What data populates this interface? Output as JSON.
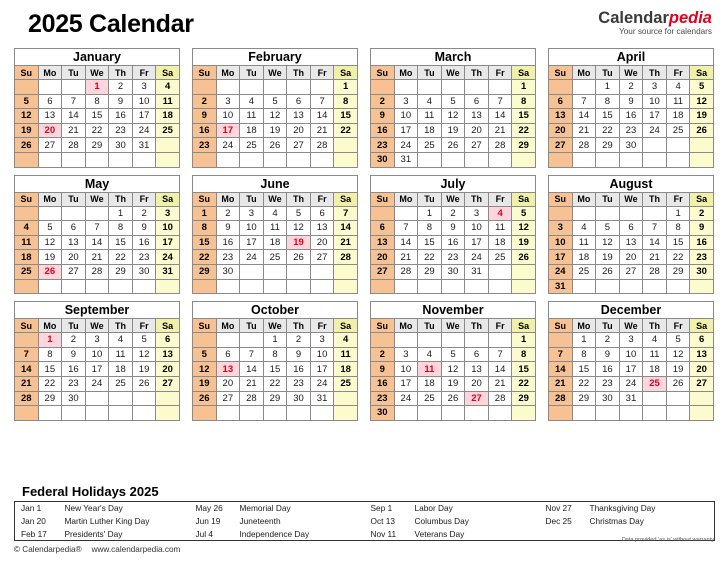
{
  "header": {
    "title": "2025 Calendar",
    "brand_name_1": "Calendar",
    "brand_name_2": "pedia",
    "brand_tagline": "Your source for calendars"
  },
  "colors": {
    "sunday_bg": "#f7c293",
    "saturday_bg": "#fbfbcd",
    "saturday_header_bg": "#f0f0a8",
    "weekday_header_bg": "#e8e8e8",
    "holiday_bg": "#fcd5dd",
    "holiday_text": "#e2001a",
    "brand_accent": "#e2001a",
    "border": "#8a8a8a"
  },
  "weekdays": [
    "Su",
    "Mo",
    "Tu",
    "We",
    "Th",
    "Fr",
    "Sa"
  ],
  "months": [
    {
      "name": "January",
      "weeks": [
        [
          "",
          "",
          "",
          "1",
          "2",
          "3",
          "4"
        ],
        [
          "5",
          "6",
          "7",
          "8",
          "9",
          "10",
          "11"
        ],
        [
          "12",
          "13",
          "14",
          "15",
          "16",
          "17",
          "18"
        ],
        [
          "19",
          "20",
          "21",
          "22",
          "23",
          "24",
          "25"
        ],
        [
          "26",
          "27",
          "28",
          "29",
          "30",
          "31",
          ""
        ],
        [
          "",
          "",
          "",
          "",
          "",
          "",
          ""
        ]
      ],
      "holidays": [
        "1",
        "20"
      ]
    },
    {
      "name": "February",
      "weeks": [
        [
          "",
          "",
          "",
          "",
          "",
          "",
          "1"
        ],
        [
          "2",
          "3",
          "4",
          "5",
          "6",
          "7",
          "8"
        ],
        [
          "9",
          "10",
          "11",
          "12",
          "13",
          "14",
          "15"
        ],
        [
          "16",
          "17",
          "18",
          "19",
          "20",
          "21",
          "22"
        ],
        [
          "23",
          "24",
          "25",
          "26",
          "27",
          "28",
          ""
        ],
        [
          "",
          "",
          "",
          "",
          "",
          "",
          ""
        ]
      ],
      "holidays": [
        "17"
      ]
    },
    {
      "name": "March",
      "weeks": [
        [
          "",
          "",
          "",
          "",
          "",
          "",
          "1"
        ],
        [
          "2",
          "3",
          "4",
          "5",
          "6",
          "7",
          "8"
        ],
        [
          "9",
          "10",
          "11",
          "12",
          "13",
          "14",
          "15"
        ],
        [
          "16",
          "17",
          "18",
          "19",
          "20",
          "21",
          "22"
        ],
        [
          "23",
          "24",
          "25",
          "26",
          "27",
          "28",
          "29"
        ],
        [
          "30",
          "31",
          "",
          "",
          "",
          "",
          ""
        ]
      ],
      "holidays": []
    },
    {
      "name": "April",
      "weeks": [
        [
          "",
          "",
          "1",
          "2",
          "3",
          "4",
          "5"
        ],
        [
          "6",
          "7",
          "8",
          "9",
          "10",
          "11",
          "12"
        ],
        [
          "13",
          "14",
          "15",
          "16",
          "17",
          "18",
          "19"
        ],
        [
          "20",
          "21",
          "22",
          "23",
          "24",
          "25",
          "26"
        ],
        [
          "27",
          "28",
          "29",
          "30",
          "",
          "",
          ""
        ],
        [
          "",
          "",
          "",
          "",
          "",
          "",
          ""
        ]
      ],
      "holidays": []
    },
    {
      "name": "May",
      "weeks": [
        [
          "",
          "",
          "",
          "",
          "1",
          "2",
          "3"
        ],
        [
          "4",
          "5",
          "6",
          "7",
          "8",
          "9",
          "10"
        ],
        [
          "11",
          "12",
          "13",
          "14",
          "15",
          "16",
          "17"
        ],
        [
          "18",
          "19",
          "20",
          "21",
          "22",
          "23",
          "24"
        ],
        [
          "25",
          "26",
          "27",
          "28",
          "29",
          "30",
          "31"
        ],
        [
          "",
          "",
          "",
          "",
          "",
          "",
          ""
        ]
      ],
      "holidays": [
        "26"
      ]
    },
    {
      "name": "June",
      "weeks": [
        [
          "1",
          "2",
          "3",
          "4",
          "5",
          "6",
          "7"
        ],
        [
          "8",
          "9",
          "10",
          "11",
          "12",
          "13",
          "14"
        ],
        [
          "15",
          "16",
          "17",
          "18",
          "19",
          "20",
          "21"
        ],
        [
          "22",
          "23",
          "24",
          "25",
          "26",
          "27",
          "28"
        ],
        [
          "29",
          "30",
          "",
          "",
          "",
          "",
          ""
        ],
        [
          "",
          "",
          "",
          "",
          "",
          "",
          ""
        ]
      ],
      "holidays": [
        "19"
      ]
    },
    {
      "name": "July",
      "weeks": [
        [
          "",
          "",
          "1",
          "2",
          "3",
          "4",
          "5"
        ],
        [
          "6",
          "7",
          "8",
          "9",
          "10",
          "11",
          "12"
        ],
        [
          "13",
          "14",
          "15",
          "16",
          "17",
          "18",
          "19"
        ],
        [
          "20",
          "21",
          "22",
          "23",
          "24",
          "25",
          "26"
        ],
        [
          "27",
          "28",
          "29",
          "30",
          "31",
          "",
          ""
        ],
        [
          "",
          "",
          "",
          "",
          "",
          "",
          ""
        ]
      ],
      "holidays": [
        "4"
      ]
    },
    {
      "name": "August",
      "weeks": [
        [
          "",
          "",
          "",
          "",
          "",
          "1",
          "2"
        ],
        [
          "3",
          "4",
          "5",
          "6",
          "7",
          "8",
          "9"
        ],
        [
          "10",
          "11",
          "12",
          "13",
          "14",
          "15",
          "16"
        ],
        [
          "17",
          "18",
          "19",
          "20",
          "21",
          "22",
          "23"
        ],
        [
          "24",
          "25",
          "26",
          "27",
          "28",
          "29",
          "30"
        ],
        [
          "31",
          "",
          "",
          "",
          "",
          "",
          ""
        ]
      ],
      "holidays": []
    },
    {
      "name": "September",
      "weeks": [
        [
          "",
          "1",
          "2",
          "3",
          "4",
          "5",
          "6"
        ],
        [
          "7",
          "8",
          "9",
          "10",
          "11",
          "12",
          "13"
        ],
        [
          "14",
          "15",
          "16",
          "17",
          "18",
          "19",
          "20"
        ],
        [
          "21",
          "22",
          "23",
          "24",
          "25",
          "26",
          "27"
        ],
        [
          "28",
          "29",
          "30",
          "",
          "",
          "",
          ""
        ],
        [
          "",
          "",
          "",
          "",
          "",
          "",
          ""
        ]
      ],
      "holidays": [
        "1"
      ]
    },
    {
      "name": "October",
      "weeks": [
        [
          "",
          "",
          "",
          "1",
          "2",
          "3",
          "4"
        ],
        [
          "5",
          "6",
          "7",
          "8",
          "9",
          "10",
          "11"
        ],
        [
          "12",
          "13",
          "14",
          "15",
          "16",
          "17",
          "18"
        ],
        [
          "19",
          "20",
          "21",
          "22",
          "23",
          "24",
          "25"
        ],
        [
          "26",
          "27",
          "28",
          "29",
          "30",
          "31",
          ""
        ],
        [
          "",
          "",
          "",
          "",
          "",
          "",
          ""
        ]
      ],
      "holidays": [
        "13"
      ]
    },
    {
      "name": "November",
      "weeks": [
        [
          "",
          "",
          "",
          "",
          "",
          "",
          "1"
        ],
        [
          "2",
          "3",
          "4",
          "5",
          "6",
          "7",
          "8"
        ],
        [
          "9",
          "10",
          "11",
          "12",
          "13",
          "14",
          "15"
        ],
        [
          "16",
          "17",
          "18",
          "19",
          "20",
          "21",
          "22"
        ],
        [
          "23",
          "24",
          "25",
          "26",
          "27",
          "28",
          "29"
        ],
        [
          "30",
          "",
          "",
          "",
          "",
          "",
          ""
        ]
      ],
      "holidays": [
        "11",
        "27"
      ]
    },
    {
      "name": "December",
      "weeks": [
        [
          "",
          "1",
          "2",
          "3",
          "4",
          "5",
          "6"
        ],
        [
          "7",
          "8",
          "9",
          "10",
          "11",
          "12",
          "13"
        ],
        [
          "14",
          "15",
          "16",
          "17",
          "18",
          "19",
          "20"
        ],
        [
          "21",
          "22",
          "23",
          "24",
          "25",
          "26",
          "27"
        ],
        [
          "28",
          "29",
          "30",
          "31",
          "",
          "",
          ""
        ],
        [
          "",
          "",
          "",
          "",
          "",
          "",
          ""
        ]
      ],
      "holidays": [
        "25"
      ]
    }
  ],
  "holidays_section": {
    "title": "Federal Holidays 2025",
    "rows": [
      [
        {
          "date": "Jan 1",
          "name": "New Year's Day"
        },
        {
          "date": "May 26",
          "name": "Memorial Day"
        },
        {
          "date": "Sep 1",
          "name": "Labor Day"
        },
        {
          "date": "Nov 27",
          "name": "Thanksgiving Day"
        }
      ],
      [
        {
          "date": "Jan 20",
          "name": "Martin Luther King Day"
        },
        {
          "date": "Jun 19",
          "name": "Juneteenth"
        },
        {
          "date": "Oct 13",
          "name": "Columbus Day"
        },
        {
          "date": "Dec 25",
          "name": "Christmas Day"
        }
      ],
      [
        {
          "date": "Feb 17",
          "name": "Presidents' Day"
        },
        {
          "date": "Jul 4",
          "name": "Independence Day"
        },
        {
          "date": "Nov 11",
          "name": "Veterans Day"
        },
        {
          "date": "",
          "name": ""
        }
      ]
    ]
  },
  "footer": {
    "copyright": "© Calendarpedia®",
    "website": "www.calendarpedia.com",
    "disclaimer": "Data provided 'as is' without warranty"
  }
}
